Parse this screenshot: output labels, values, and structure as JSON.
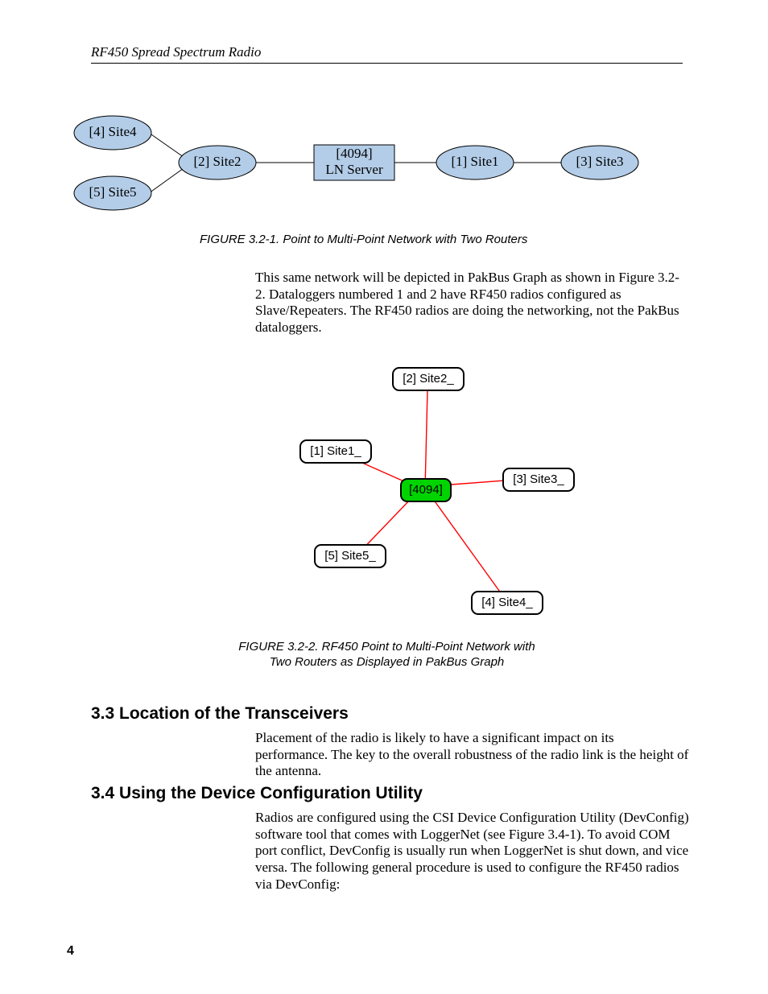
{
  "header": {
    "title": "RF450 Spread Spectrum Radio"
  },
  "page_number": "4",
  "figure1": {
    "nodes": {
      "site4": "[4] Site4",
      "site5": "[5] Site5",
      "site2": "[2] Site2",
      "server_top": "[4094]",
      "server_bottom": "LN Server",
      "site1": "[1] Site1",
      "site3": "[3] Site3"
    },
    "caption": "FIGURE 3.2-1.  Point to Multi-Point Network with Two Routers"
  },
  "paragraph1": "This same network will be depicted in PakBus Graph as shown in Figure 3.2-2.  Dataloggers numbered 1 and 2 have RF450 radios configured as Slave/Repeaters.  The RF450 radios are doing the networking, not the PakBus dataloggers.",
  "figure2": {
    "nodes": {
      "site2": "[2] Site2_",
      "site1": "[1] Site1_",
      "center": "[4094]",
      "site3": "[3] Site3_",
      "site5": "[5] Site5_",
      "site4": "[4] Site4_"
    },
    "caption_line1": "FIGURE 3.2-2.  RF450 Point to Multi-Point Network with",
    "caption_line2": "Two Routers as Displayed in PakBus Graph"
  },
  "section33": {
    "heading": "3.3  Location of the Transceivers",
    "body": "Placement of the radio is likely to have a significant impact on its performance.  The key to the overall robustness of the radio link is the height of the antenna."
  },
  "section34": {
    "heading": "3.4  Using the Device Configuration Utility",
    "body": "Radios are configured using the CSI Device Configuration Utility (DevConfig) software tool that comes with LoggerNet (see Figure 3.4-1).  To avoid COM port conflict, DevConfig is usually run when LoggerNet is shut down, and vice versa.  The following general procedure is used to configure the RF450 radios via DevConfig:"
  },
  "chart_data": [
    {
      "type": "diagram",
      "title": "Point to Multi-Point Network with Two Routers",
      "nodes": [
        {
          "id": "site4",
          "label": "[4] Site4",
          "shape": "ellipse"
        },
        {
          "id": "site5",
          "label": "[5] Site5",
          "shape": "ellipse"
        },
        {
          "id": "site2",
          "label": "[2] Site2",
          "shape": "ellipse"
        },
        {
          "id": "server",
          "label": "[4094] LN Server",
          "shape": "rect"
        },
        {
          "id": "site1",
          "label": "[1] Site1",
          "shape": "ellipse"
        },
        {
          "id": "site3",
          "label": "[3] Site3",
          "shape": "ellipse"
        }
      ],
      "edges": [
        [
          "site4",
          "site2"
        ],
        [
          "site5",
          "site2"
        ],
        [
          "site2",
          "server"
        ],
        [
          "server",
          "site1"
        ],
        [
          "site1",
          "site3"
        ]
      ]
    },
    {
      "type": "diagram",
      "title": "RF450 Point to Multi-Point Network with Two Routers as Displayed in PakBus Graph",
      "nodes": [
        {
          "id": "center",
          "label": "[4094]",
          "shape": "roundrect",
          "color": "green"
        },
        {
          "id": "site1",
          "label": "[1] Site1_",
          "shape": "roundrect"
        },
        {
          "id": "site2",
          "label": "[2] Site2_",
          "shape": "roundrect"
        },
        {
          "id": "site3",
          "label": "[3] Site3_",
          "shape": "roundrect"
        },
        {
          "id": "site4",
          "label": "[4] Site4_",
          "shape": "roundrect"
        },
        {
          "id": "site5",
          "label": "[5] Site5_",
          "shape": "roundrect"
        }
      ],
      "edges": [
        [
          "center",
          "site1"
        ],
        [
          "center",
          "site2"
        ],
        [
          "center",
          "site3"
        ],
        [
          "center",
          "site4"
        ],
        [
          "center",
          "site5"
        ]
      ]
    }
  ]
}
